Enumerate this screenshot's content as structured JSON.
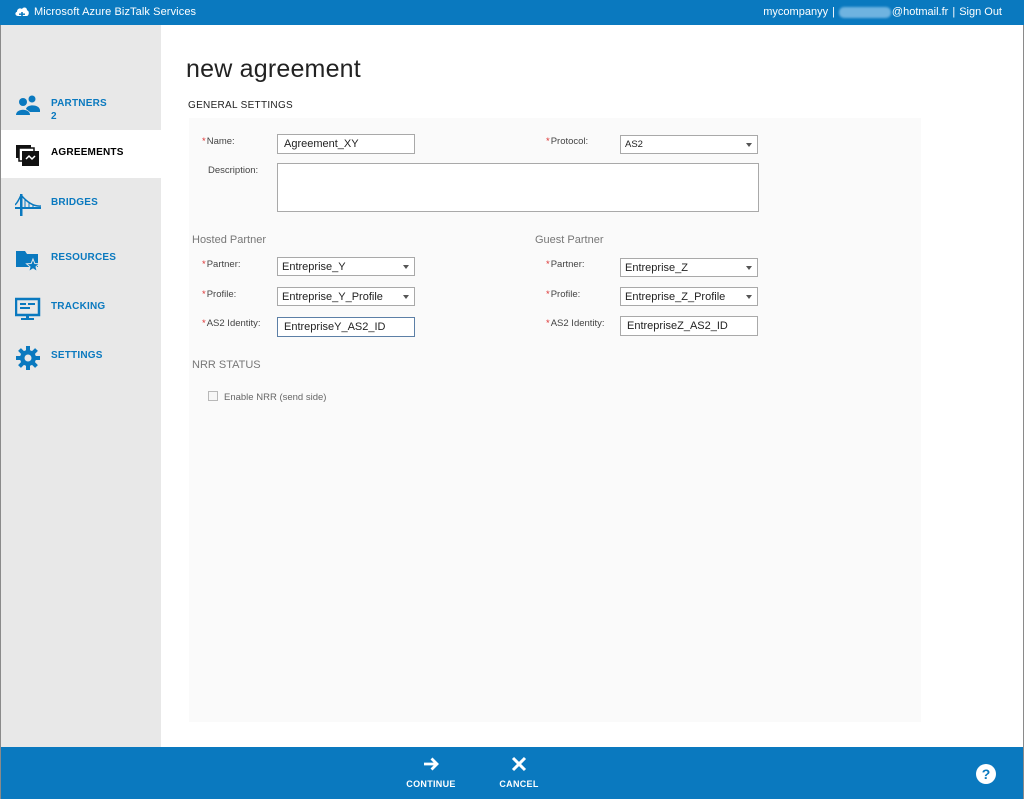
{
  "header": {
    "title": "Microsoft Azure BizTalk Services",
    "user": "mycompanyy",
    "email_suffix": "@hotmail.fr",
    "separator1": "|",
    "separator2": "|",
    "sign_out": "Sign Out"
  },
  "sidebar": {
    "items": [
      {
        "label": "PARTNERS",
        "count": "2",
        "icon": "partners-icon"
      },
      {
        "label": "AGREEMENTS",
        "icon": "agreements-icon",
        "active": true
      },
      {
        "label": "BRIDGES",
        "icon": "bridges-icon"
      },
      {
        "label": "RESOURCES",
        "icon": "resources-icon"
      },
      {
        "label": "TRACKING",
        "icon": "tracking-icon"
      },
      {
        "label": "SETTINGS",
        "icon": "settings-icon"
      }
    ]
  },
  "page": {
    "title": "new agreement",
    "section": "GENERAL SETTINGS"
  },
  "form": {
    "required_mark": "*",
    "name_label": "Name:",
    "name_value": "Agreement_XY",
    "protocol_label": "Protocol:",
    "protocol_value": "AS2",
    "description_label": "Description:",
    "description_value": "",
    "hosted": {
      "title": "Hosted Partner",
      "partner_label": "Partner:",
      "partner_value": "Entreprise_Y",
      "profile_label": "Profile:",
      "profile_value": "Entreprise_Y_Profile",
      "identity_label": "AS2 Identity:",
      "identity_value": "EntrepriseY_AS2_ID"
    },
    "guest": {
      "title": "Guest Partner",
      "partner_label": "Partner:",
      "partner_value": "Entreprise_Z",
      "profile_label": "Profile:",
      "profile_value": "Entreprise_Z_Profile",
      "identity_label": "AS2 Identity:",
      "identity_value": "EntrepriseZ_AS2_ID"
    },
    "nrr_title": "NRR STATUS",
    "nrr_checkbox_label": "Enable NRR (send side)"
  },
  "footer": {
    "continue_label": "CONTINUE",
    "cancel_label": "CANCEL",
    "help_label": "?"
  },
  "colors": {
    "brand": "#0a79bf",
    "sidebar_bg": "#e8e8e8",
    "required": "#dd3333"
  }
}
